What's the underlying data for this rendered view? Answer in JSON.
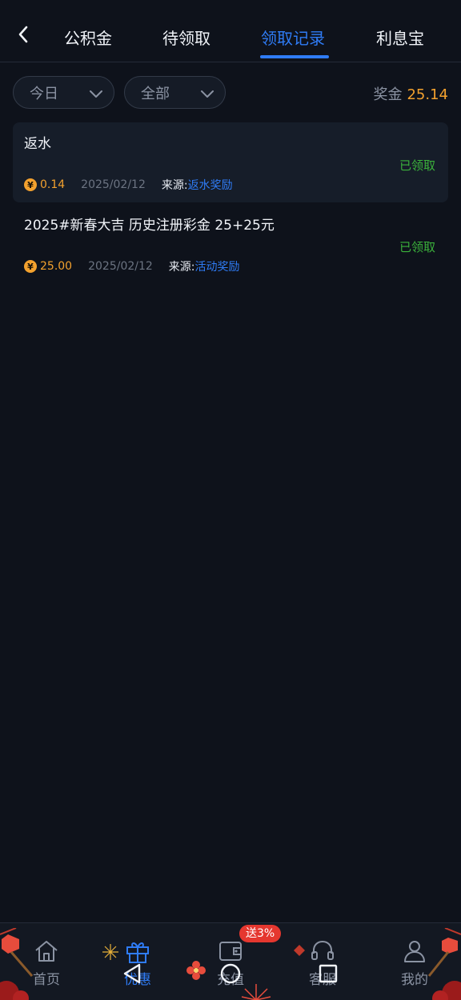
{
  "tabs": [
    {
      "label": "公积金",
      "active": false
    },
    {
      "label": "待领取",
      "active": false
    },
    {
      "label": "领取记录",
      "active": true
    },
    {
      "label": "利息宝",
      "active": false
    }
  ],
  "filters": {
    "date": "今日",
    "type": "全部"
  },
  "bonus": {
    "label": "奖金",
    "amount": "25.14"
  },
  "records": [
    {
      "title": "返水",
      "status": "已领取",
      "amount": "0.14",
      "date": "2025/02/12",
      "source_label": "来源:",
      "source_value": "返水奖励"
    },
    {
      "title": "2025#新春大吉 历史注册彩金 25+25元",
      "status": "已领取",
      "amount": "25.00",
      "date": "2025/02/12",
      "source_label": "来源:",
      "source_value": "活动奖励"
    }
  ],
  "currency_symbol": "¥",
  "bottom_nav": [
    {
      "label": "首页",
      "icon": "home-icon",
      "active": false
    },
    {
      "label": "优惠",
      "icon": "gift-icon",
      "active": true
    },
    {
      "label": "充值",
      "icon": "wallet-icon",
      "active": false
    },
    {
      "label": "客服",
      "icon": "headset-icon",
      "active": false
    },
    {
      "label": "我的",
      "icon": "user-icon",
      "active": false
    }
  ],
  "promo_badge": "送3%",
  "colors": {
    "accent": "#2f7cf6",
    "gold": "#f3a12e",
    "success": "#3bb23b",
    "background": "#0e121b",
    "badge": "#e5372f"
  }
}
